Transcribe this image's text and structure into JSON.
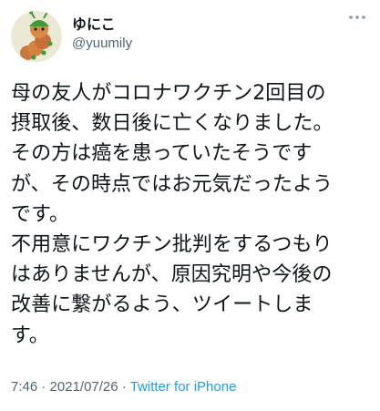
{
  "author": {
    "display_name": "ゆにこ",
    "handle": "@yuumily",
    "avatar_icon": "caterpillar-avatar-icon"
  },
  "more_icon": "more-options-icon",
  "tweet": {
    "lines": [
      "母の友人がコロナワクチン2回目の",
      "摂取後、数日後に亡くなりました。",
      "その方は癌を患っていたそうです",
      "が、その時点ではお元気だったよう",
      "です。",
      "不用意にワクチン批判をするつもり",
      "はありませんが、原因究明や今後の",
      "改善に繋がるよう、ツイートしま",
      "す。"
    ]
  },
  "meta": {
    "time": "7:46",
    "separator": " · ",
    "date": "2021/07/26",
    "source": "Twitter for iPhone"
  },
  "colors": {
    "text": "#0f1419",
    "secondary": "#536471",
    "link": "#1d9bf0"
  }
}
